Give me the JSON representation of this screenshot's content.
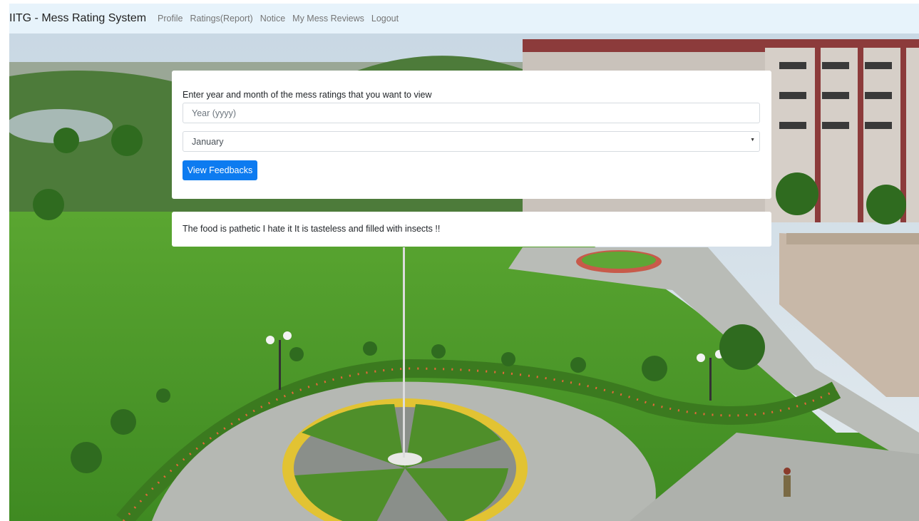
{
  "navbar": {
    "brand": "IITG - Mess Rating System",
    "links": [
      "Profile",
      "Ratings(Report)",
      "Notice",
      "My Mess Reviews",
      "Logout"
    ]
  },
  "form": {
    "prompt": "Enter year and month of the mess ratings that you want to view",
    "year_placeholder": "Year (yyyy)",
    "month_selected": "January",
    "submit_label": "View Feedbacks"
  },
  "feedback": {
    "message": "The food is pathetic I hate it It is tasteless and filled with insects !!"
  },
  "colors": {
    "navbar_bg": "#e7f3fb",
    "primary_button": "#0d7bf0",
    "lawn": "#4f9a2a"
  }
}
